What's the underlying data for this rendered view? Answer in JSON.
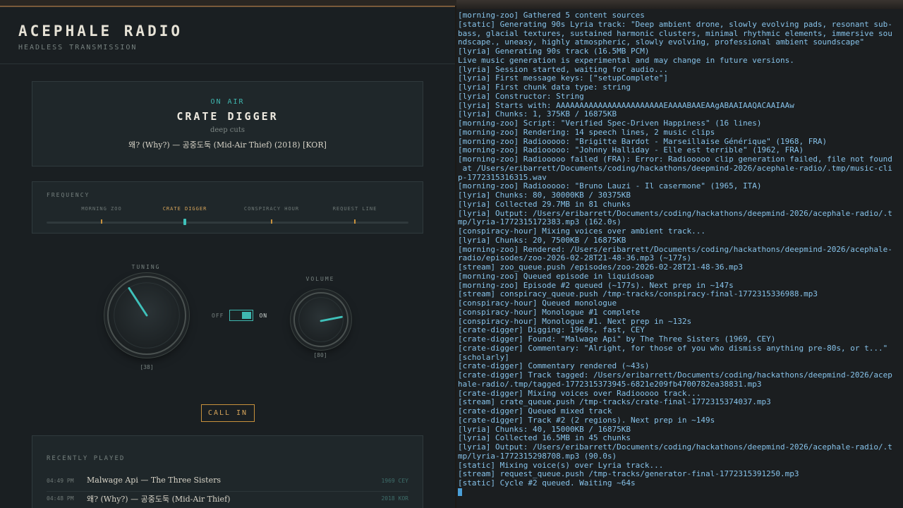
{
  "app": {
    "title": "ACEPHALE RADIO",
    "subtitle": "HEADLESS TRANSMISSION",
    "now_playing": {
      "status": "ON AIR",
      "show": "CRATE DIGGER",
      "tagline": "deep cuts",
      "track": "왜? (Why?) — 공중도둑 (Mid-Air Thief) (2018) [KOR]"
    },
    "frequency": {
      "label": "FREQUENCY",
      "stations": [
        "MORNING ZOO",
        "CRATE DIGGER",
        "CONSPIRACY HOUR",
        "REQUEST LINE"
      ],
      "active_index": 1
    },
    "tuning": {
      "label": "TUNING",
      "value": 38,
      "display": "[38]"
    },
    "power": {
      "off_label": "OFF",
      "on_label": "ON",
      "state": "on"
    },
    "volume": {
      "label": "VOLUME",
      "value": 80,
      "display": "[80]"
    },
    "call_in_label": "CALL IN",
    "recent": {
      "title": "RECENTLY PLAYED",
      "items": [
        {
          "time": "04:49 PM",
          "title": "Malwage Api — The Three Sisters",
          "meta": "1969 CEY"
        },
        {
          "time": "04:48 PM",
          "title": "왜? (Why?) — 공중도둑 (Mid-Air Thief)",
          "meta": "2018 KOR"
        }
      ]
    },
    "colors": {
      "accent": "#3fb7b0",
      "amber": "#c8913c",
      "bg": "#1a1f22"
    }
  },
  "terminal": {
    "lines": [
      "[morning-zoo] Gathered 5 content sources",
      "[static] Generating 90s Lyria track: \"Deep ambient drone, slowly evolving pads, resonant sub-",
      "bass, glacial textures, sustained harmonic clusters, minimal rhythmic elements, immersive sou",
      "ndscape., uneasy, highly atmospheric, slowly evolving, professional ambient soundscape\"",
      "[lyria] Generating 90s track (16.5MB PCM)",
      "Live music generation is experimental and may change in future versions.",
      "[lyria] Session started, waiting for audio...",
      "[lyria] First message keys: [\"setupComplete\"]",
      "[lyria] First chunk data type: string",
      "[lyria] Constructor: String",
      "[lyria] Starts with: AAAAAAAAAAAAAAAAAAAAAAAEAAAABAAEAAgABAAIAAQACAAIAAw",
      "[lyria] Chunks: 1, 375KB / 16875KB",
      "[morning-zoo] Script: \"Verified Spec-Driven Happiness\" (16 lines)",
      "[morning-zoo] Rendering: 14 speech lines, 2 music clips",
      "[morning-zoo] Radiooooo: \"Brigitte Bardot - Marseillaise Générique\" (1968, FRA)",
      "[morning-zoo] Radiooooo: \"Johnny Halliday - Elle est terrible\" (1962, FRA)",
      "[morning-zoo] Radiooooo failed (FRA): Error: Radiooooo clip generation failed, file not found",
      " at /Users/eribarrett/Documents/coding/hackathons/deepmind-2026/acephale-radio/.tmp/music-cli",
      "p-1772315316315.wav",
      "[morning-zoo] Radiooooo: \"Bruno Lauzi - Il casermone\" (1965, ITA)",
      "[lyria] Chunks: 80, 30000KB / 30375KB",
      "[lyria] Collected 29.7MB in 81 chunks",
      "[lyria] Output: /Users/eribarrett/Documents/coding/hackathons/deepmind-2026/acephale-radio/.t",
      "mp/lyria-1772315172383.mp3 (162.0s)",
      "[conspiracy-hour] Mixing voices over ambient track...",
      "[lyria] Chunks: 20, 7500KB / 16875KB",
      "[morning-zoo] Rendered: /Users/eribarrett/Documents/coding/hackathons/deepmind-2026/acephale-",
      "radio/episodes/zoo-2026-02-28T21-48-36.mp3 (~177s)",
      "[stream] zoo_queue.push /episodes/zoo-2026-02-28T21-48-36.mp3",
      "[morning-zoo] Queued episode in liquidsoap",
      "[morning-zoo] Episode #2 queued (~177s). Next prep in ~147s",
      "[stream] conspiracy_queue.push /tmp-tracks/conspiracy-final-1772315336988.mp3",
      "[conspiracy-hour] Queued monologue",
      "[conspiracy-hour] Monologue #1 complete",
      "[conspiracy-hour] Monologue #1. Next prep in ~132s",
      "[crate-digger] Digging: 1960s, fast, CEY",
      "[crate-digger] Found: \"Malwage Api\" by The Three Sisters (1969, CEY)",
      "[crate-digger] Commentary: \"Alright, for those of you who dismiss anything pre-80s, or t...\"",
      "[scholarly]",
      "[crate-digger] Commentary rendered (~43s)",
      "[crate-digger] Track tagged: /Users/eribarrett/Documents/coding/hackathons/deepmind-2026/acep",
      "hale-radio/.tmp/tagged-1772315373945-6821e209fb4700782ea38831.mp3",
      "[crate-digger] Mixing voices over Radiooooo track...",
      "[stream] crate_queue.push /tmp-tracks/crate-final-1772315374037.mp3",
      "[crate-digger] Queued mixed track",
      "[crate-digger] Track #2 (2 regions). Next prep in ~149s",
      "[lyria] Chunks: 40, 15000KB / 16875KB",
      "[lyria] Collected 16.5MB in 45 chunks",
      "[lyria] Output: /Users/eribarrett/Documents/coding/hackathons/deepmind-2026/acephale-radio/.t",
      "mp/lyria-1772315298708.mp3 (90.0s)",
      "[static] Mixing voice(s) over Lyria track...",
      "[stream] request_queue.push /tmp-tracks/generator-final-1772315391250.mp3",
      "[static] Cycle #2 queued. Waiting ~64s"
    ]
  }
}
